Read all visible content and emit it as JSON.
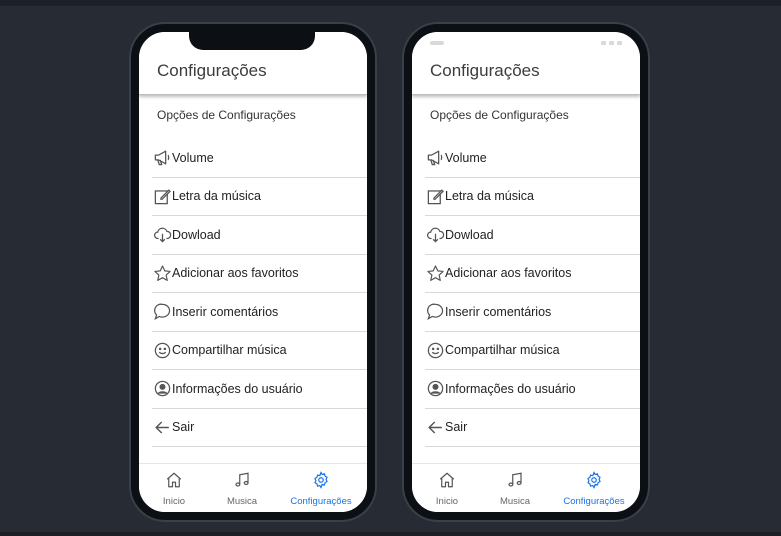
{
  "colors": {
    "accent": "#1a73e8",
    "icon": "#555555",
    "background": "#272c34",
    "bezel": "#0c0f14"
  },
  "header": {
    "title": "Configurações"
  },
  "section": {
    "title": "Opções de Configurações"
  },
  "menu": {
    "items": [
      {
        "label": "Volume",
        "icon": "megaphone-icon"
      },
      {
        "label": "Letra da música",
        "icon": "edit-icon"
      },
      {
        "label": "Dowload",
        "icon": "cloud-download-icon"
      },
      {
        "label": "Adicionar aos favoritos",
        "icon": "star-icon"
      },
      {
        "label": "Inserir comentários",
        "icon": "chat-bubble-icon"
      },
      {
        "label": "Compartilhar música",
        "icon": "smile-icon"
      },
      {
        "label": "Informações do usuário",
        "icon": "user-circle-icon"
      },
      {
        "label": "Sair",
        "icon": "arrow-left-icon"
      }
    ]
  },
  "tabs": {
    "home": {
      "label": "Inicio",
      "icon": "home-icon"
    },
    "music": {
      "label": "Musica",
      "icon": "music-note-icon"
    },
    "settings": {
      "label": "Configurações",
      "icon": "gear-icon",
      "active": true
    }
  }
}
